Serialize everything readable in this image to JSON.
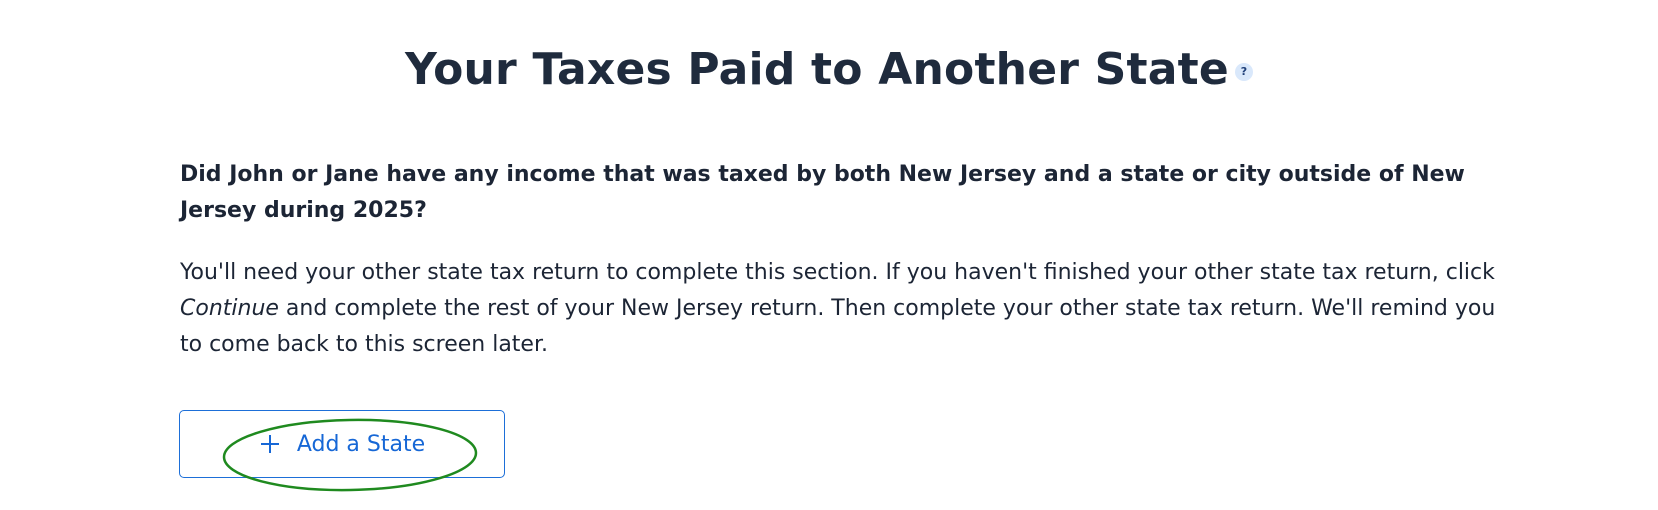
{
  "header": {
    "title": "Your Taxes Paid to Another State",
    "help_icon_glyph": "?"
  },
  "main": {
    "question": "Did John or Jane have any income that was taxed by both New Jersey and a state or city outside of New Jersey during 2025?",
    "instructions_before": "You'll need your other state tax return to complete this section. If you haven't finished your other state tax return, click ",
    "instructions_emphasis": "Continue",
    "instructions_after": " and complete the rest of your New Jersey return. Then complete your other state tax return. We'll remind you to come back to this screen later."
  },
  "actions": {
    "add_state_label": "Add a State",
    "add_state_icon": "plus-icon"
  },
  "colors": {
    "text": "#1c2535",
    "accent": "#1667d6",
    "help_badge_bg": "#d9e8fb",
    "annotation": "#1f8a1f"
  }
}
